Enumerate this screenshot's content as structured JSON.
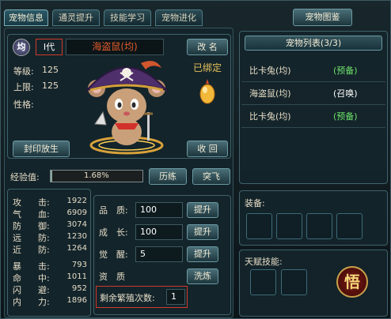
{
  "tabs": [
    {
      "label": "宠物信息"
    },
    {
      "label": "通灵提升"
    },
    {
      "label": "技能学习"
    },
    {
      "label": "宠物进化"
    }
  ],
  "codex_button": "宠物图鉴",
  "pet": {
    "badge": "均",
    "generation": "I代",
    "name": "海盗鼠(均)",
    "level_label": "等级:",
    "level": "125",
    "cap_label": "上限:",
    "cap": "125",
    "nature_label": "性格:",
    "nature": "",
    "rename_button": "改 名",
    "bound_status": "已绑定",
    "seal_button": "封印放生",
    "recall_button": "收 回"
  },
  "exp": {
    "label": "经验值:",
    "percent_text": "1.68%",
    "progress": 0.0168,
    "train_button": "历练",
    "breakthrough_button": "突飞"
  },
  "attributes": [
    {
      "a": "攻",
      "b": "击:",
      "value": "1922"
    },
    {
      "a": "气",
      "b": "血:",
      "value": "6909"
    },
    {
      "a": "防",
      "b": "御:",
      "value": "3074"
    },
    {
      "a": "远",
      "b": "防:",
      "value": "1230"
    },
    {
      "a": "近",
      "b": "防:",
      "value": "1264"
    },
    {
      "a": "暴",
      "b": "击:",
      "value": "793"
    },
    {
      "a": "命",
      "b": "中:",
      "value": "1011"
    },
    {
      "a": "闪",
      "b": "避:",
      "value": "952"
    },
    {
      "a": "内",
      "b": "力:",
      "value": "1896"
    }
  ],
  "aptitude": {
    "quality_label": "品　质:",
    "quality": "100",
    "quality_btn": "提升",
    "growth_label": "成　长:",
    "growth": "100",
    "growth_btn": "提升",
    "awaken_label": "觉　醒:",
    "awaken": "5",
    "awaken_btn": "提升",
    "aptitude_label": "资　质",
    "wash_btn": "洗炼",
    "breed_label": "剩余繁殖次数:",
    "breed": "1"
  },
  "pet_list": {
    "title": "宠物列表(3/3)",
    "items": [
      {
        "name": "比卡兔(均)",
        "status": "(预备)",
        "color": "#6ee36a"
      },
      {
        "name": "海盗鼠(均)",
        "status": "(召唤)",
        "color": "#ffffff"
      },
      {
        "name": "比卡兔(均)",
        "status": "(预备)",
        "color": "#6ee36a"
      }
    ]
  },
  "equip_label": "装备:",
  "talent_label": "天赋技能:",
  "enlighten_glyph": "悟",
  "colors": {
    "accent_red": "#d23a2a",
    "gold": "#e8c25a",
    "status_green": "#6ee36a"
  }
}
